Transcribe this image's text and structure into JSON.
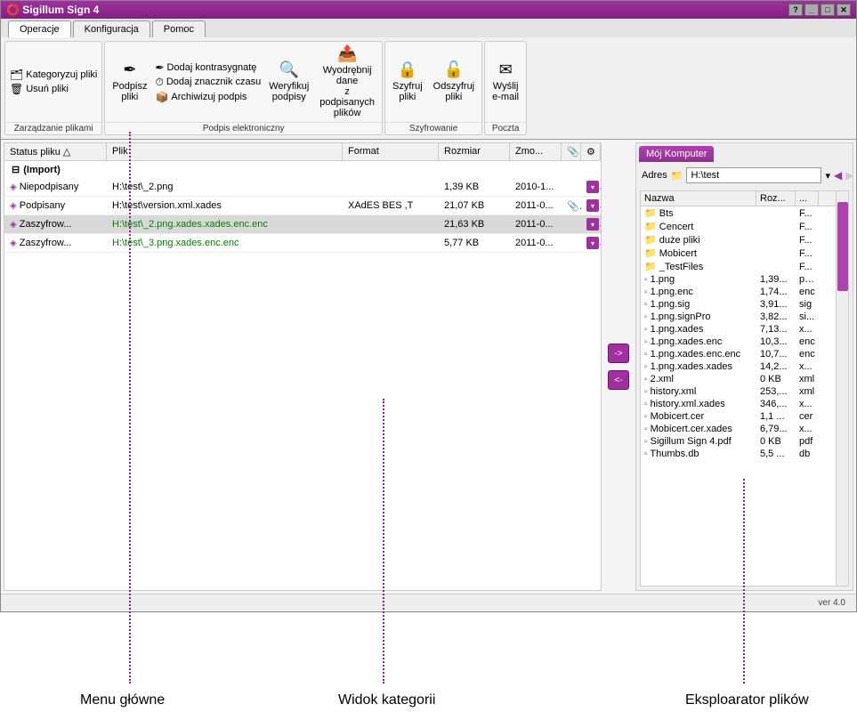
{
  "title": "Sigillum Sign 4",
  "tabs": [
    "Operacje",
    "Konfiguracja",
    "Pomoc"
  ],
  "ribbon": {
    "groups": [
      {
        "label": "Zarządzanie plikami",
        "big": [],
        "small": [
          {
            "icon": "🗂",
            "text": "Kategoryzuj pliki"
          },
          {
            "icon": "🗑",
            "text": "Usuń pliki"
          }
        ]
      },
      {
        "label": "Podpis elektroniczny",
        "big": [
          {
            "icon": "✒",
            "text": "Podpisz pliki"
          }
        ],
        "small": [
          {
            "icon": "✒",
            "text": "Dodaj kontrasygnatę"
          },
          {
            "icon": "⏱",
            "text": "Dodaj znacznik czasu"
          },
          {
            "icon": "📦",
            "text": "Archiwizuj podpis"
          }
        ],
        "big2": [
          {
            "icon": "🔍",
            "text": "Weryfikuj podpisy"
          },
          {
            "icon": "📤",
            "text": "Wyodrębnij dane z podpisanych plików"
          }
        ]
      },
      {
        "label": "Szyfrowanie",
        "big": [
          {
            "icon": "🔒",
            "text": "Szyfruj pliki"
          },
          {
            "icon": "🔓",
            "text": "Odszyfruj pliki"
          }
        ]
      },
      {
        "label": "Poczta",
        "big": [
          {
            "icon": "✉",
            "text": "Wyślij e-mail"
          }
        ]
      }
    ]
  },
  "file_headers": {
    "status": "Status pliku",
    "plik": "Plik",
    "format": "Format",
    "rozmiar": "Rozmiar",
    "zmo": "Zmo..."
  },
  "group_label": "(Import)",
  "file_rows": [
    {
      "status": "Niepodpisany",
      "plik": "H:\\test\\_2.png",
      "format": "",
      "rozmiar": "1,39 KB",
      "zmo": "2010-1...",
      "green": false,
      "selected": false,
      "dd": true
    },
    {
      "status": "Podpisany",
      "plik": "H:\\test\\version.xml.xades",
      "format": "XAdES BES ,T",
      "rozmiar": "21,07 KB",
      "zmo": "2011-0...",
      "green": false,
      "selected": false,
      "clip": true,
      "dd": true
    },
    {
      "status": "Zaszyfrow...",
      "plik": "H:\\test\\_2.png.xades.xades.enc.enc",
      "format": "",
      "rozmiar": "21,63 KB",
      "zmo": "2011-0...",
      "green": true,
      "selected": true,
      "dd": true
    },
    {
      "status": "Zaszyfrow...",
      "plik": "H:\\test\\_3.png.xades.enc.enc",
      "format": "",
      "rozmiar": "5,77 KB",
      "zmo": "2011-0...",
      "green": true,
      "selected": false,
      "dd": true
    }
  ],
  "mid_btns": [
    "->",
    "<-"
  ],
  "right": {
    "tab": "Mój Komputer",
    "addr_label": "Adres",
    "addr_value": "H:\\test",
    "headers": {
      "name": "Nazwa",
      "size": "Roz...",
      "ext": "..."
    },
    "rows": [
      {
        "name": "Bts",
        "size": "",
        "ext": "F...",
        "type": "folder"
      },
      {
        "name": "Cencert",
        "size": "",
        "ext": "F...",
        "type": "folder"
      },
      {
        "name": "duże pliki",
        "size": "",
        "ext": "F...",
        "type": "folder"
      },
      {
        "name": "Mobicert",
        "size": "",
        "ext": "F...",
        "type": "folder"
      },
      {
        "name": "_TestFiles",
        "size": "",
        "ext": "F...",
        "type": "folder"
      },
      {
        "name": "1.png",
        "size": "1,39...",
        "ext": "png",
        "type": "file"
      },
      {
        "name": "1.png.enc",
        "size": "1,74...",
        "ext": "enc",
        "type": "file"
      },
      {
        "name": "1.png.sig",
        "size": "3,91...",
        "ext": "sig",
        "type": "file"
      },
      {
        "name": "1.png.signPro",
        "size": "3,82...",
        "ext": "si...",
        "type": "file"
      },
      {
        "name": "1.png.xades",
        "size": "7,13...",
        "ext": "x...",
        "type": "file"
      },
      {
        "name": "1.png.xades.enc",
        "size": "10,3...",
        "ext": "enc",
        "type": "file"
      },
      {
        "name": "1.png.xades.enc.enc",
        "size": "10,7...",
        "ext": "enc",
        "type": "file"
      },
      {
        "name": "1.png.xades.xades",
        "size": "14,2...",
        "ext": "x...",
        "type": "file"
      },
      {
        "name": "2.xml",
        "size": "0 KB",
        "ext": "xml",
        "type": "file"
      },
      {
        "name": "history.xml",
        "size": "253,...",
        "ext": "xml",
        "type": "file"
      },
      {
        "name": "history.xml.xades",
        "size": "346,...",
        "ext": "x...",
        "type": "file"
      },
      {
        "name": "Mobicert.cer",
        "size": "1,1 ...",
        "ext": "cer",
        "type": "file"
      },
      {
        "name": "Mobicert.cer.xades",
        "size": "6,79...",
        "ext": "x...",
        "type": "file"
      },
      {
        "name": "Sigillum Sign 4.pdf",
        "size": "0 KB",
        "ext": "pdf",
        "type": "file"
      },
      {
        "name": "Thumbs.db",
        "size": "5,5 ...",
        "ext": "db",
        "type": "file"
      }
    ]
  },
  "status": "ver 4.0",
  "annotations": {
    "menu": "Menu główne",
    "widok": "Widok kategorii",
    "eksp": "Eksploarator plików"
  }
}
